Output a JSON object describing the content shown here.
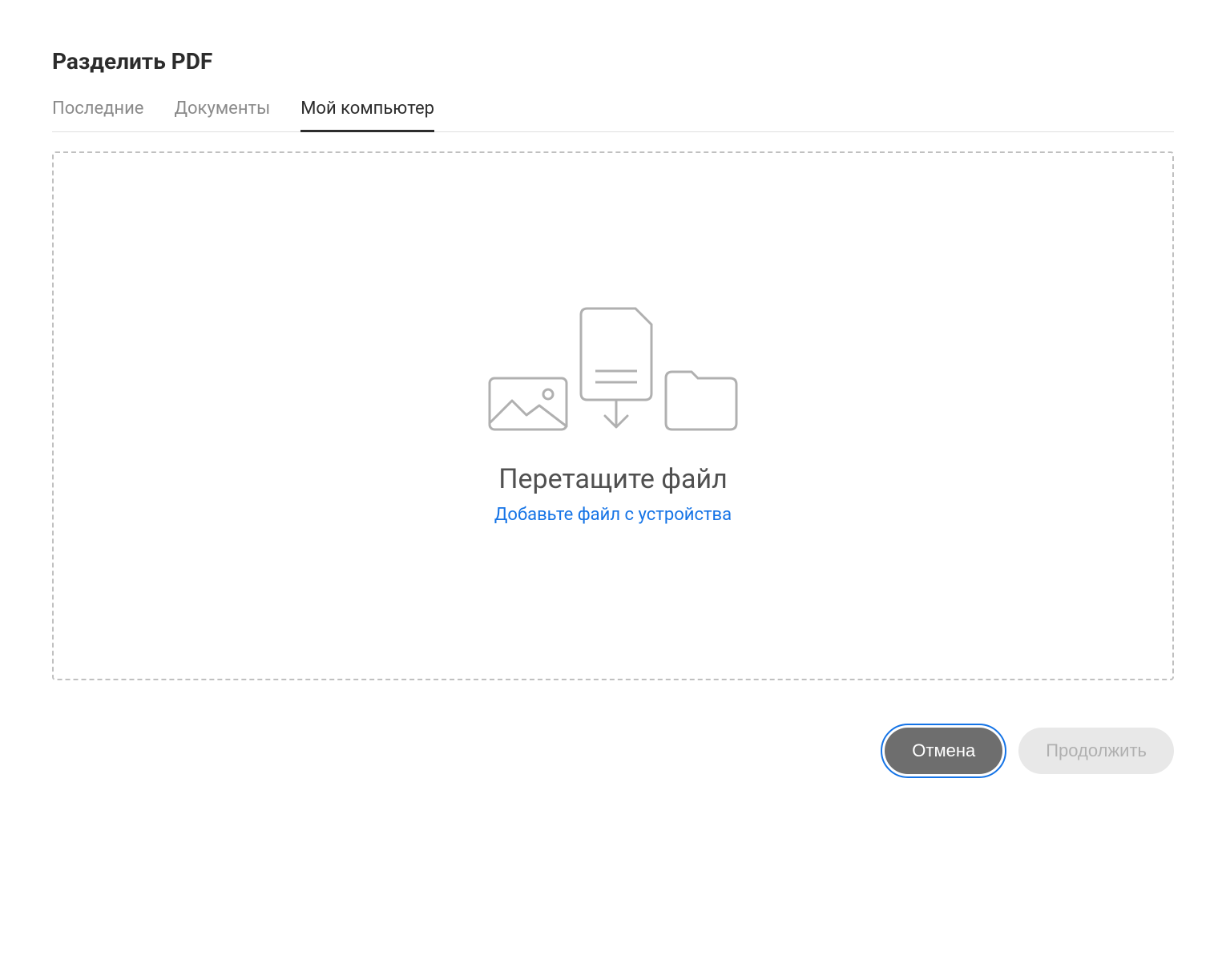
{
  "title": "Разделить PDF",
  "tabs": [
    {
      "label": "Последние",
      "active": false
    },
    {
      "label": "Документы",
      "active": false
    },
    {
      "label": "Мой компьютер",
      "active": true
    }
  ],
  "dropzone": {
    "heading": "Перетащите файл",
    "link": "Добавьте файл с устройства"
  },
  "buttons": {
    "cancel": "Отмена",
    "continue": "Продолжить"
  }
}
